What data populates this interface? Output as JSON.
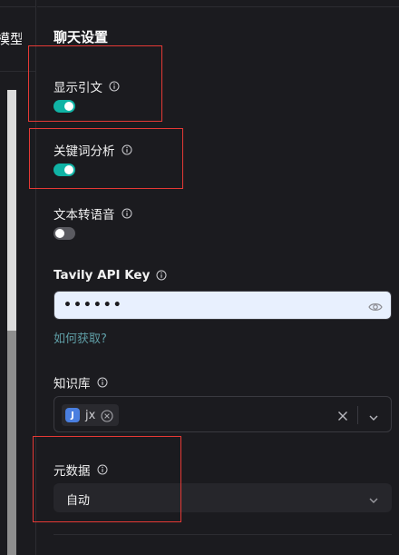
{
  "left_panel": {
    "tab_fragment": "模型"
  },
  "chat_settings": {
    "title": "聊天设置",
    "show_citation": {
      "label": "显示引文",
      "enabled": true
    },
    "keyword_analysis": {
      "label": "关键词分析",
      "enabled": true
    },
    "text_to_speech": {
      "label": "文本转语音",
      "enabled": false
    },
    "tavily": {
      "label": "Tavily API Key",
      "value": "••••••",
      "help_link": "如何获取?"
    },
    "knowledge_base": {
      "label": "知识库",
      "selected_tag": {
        "avatar_letter": "J",
        "label": "jx"
      }
    },
    "metadata": {
      "label": "元数据",
      "value": "自动"
    }
  },
  "colors": {
    "accent_toggle": "#10b3a5",
    "link": "#5f9ea6",
    "highlight_box": "#e53935",
    "input_autofill_bg": "#e8f0fe"
  },
  "icons": {
    "info": "info-circle-icon",
    "eye": "eye-icon",
    "clear": "close-icon",
    "chevron": "chevron-down-icon",
    "tag_remove": "close-circle-icon"
  }
}
